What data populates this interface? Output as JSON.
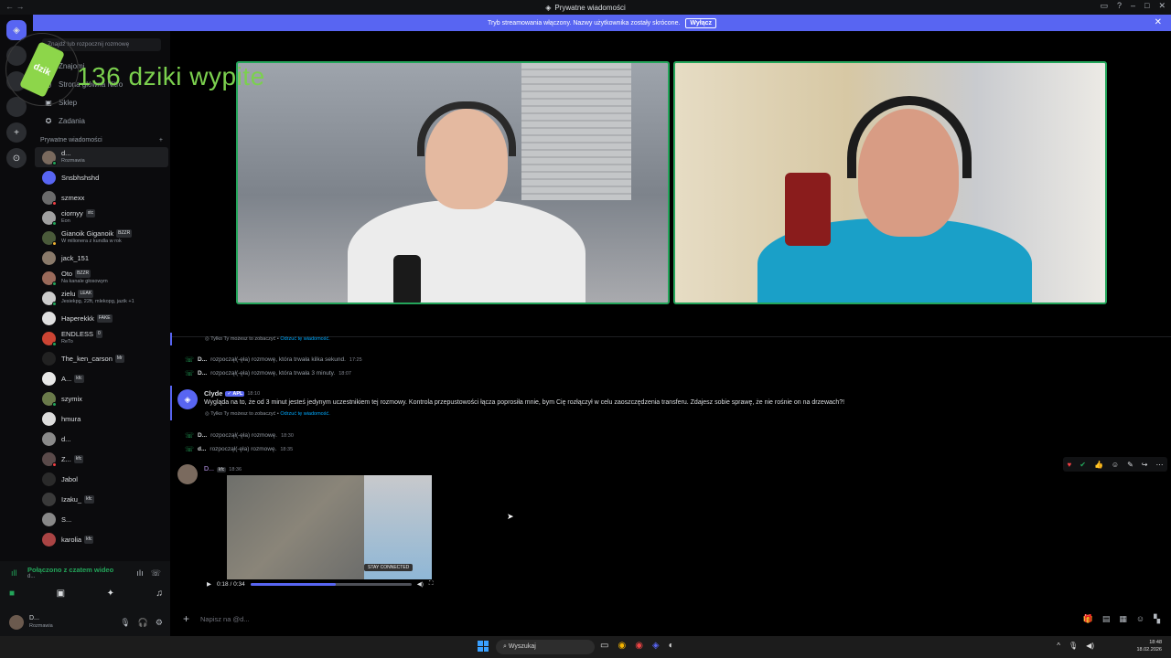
{
  "window": {
    "title": "Prywatne wiadomości"
  },
  "banner": {
    "text": "Tryb streamowania włączony. Nazwy użytkownika zostały skrócone.",
    "button": "Wyłącz"
  },
  "overlay": {
    "text": "136 dziki wypite",
    "logo_text": "dzik"
  },
  "sidebar": {
    "search_placeholder": "Znajdź lub rozpocznij rozmowę",
    "nav": [
      {
        "label": "Znajomi",
        "icon": "friends-icon"
      },
      {
        "label": "Strona główna Nitro",
        "icon": "nitro-icon"
      },
      {
        "label": "Sklep",
        "icon": "shop-icon"
      },
      {
        "label": "Zadania",
        "icon": "quests-icon"
      }
    ],
    "dm_header": "Prywatne wiadomości",
    "dms": [
      {
        "name": "d...",
        "sub": "Rozmawia",
        "color": "#7a6a5e",
        "status": "#23a55a"
      },
      {
        "name": "Snsbhshshd",
        "sub": "",
        "color": "#5865f2",
        "status": ""
      },
      {
        "name": "szmexx",
        "sub": "",
        "color": "#6b6b6b",
        "status": "#f23f43"
      },
      {
        "name": "ciornyy",
        "sub": "Eon",
        "tag": "xtc",
        "color": "#a0a0a0",
        "status": "#23a55a"
      },
      {
        "name": "Gianoik Giganoik",
        "sub": "W milionera z kundla w rok",
        "tag": "BZZR",
        "color": "#4a5a3a",
        "status": "#f0b232"
      },
      {
        "name": "jack_151",
        "sub": "",
        "color": "#8a7a6a",
        "status": ""
      },
      {
        "name": "Oto",
        "sub": "Na kanale głosowym",
        "tag": "BZZR",
        "color": "#9a6a5a",
        "status": "#23a55a"
      },
      {
        "name": "zielu",
        "sub": "Jesiekpg, 22ft, mlekopg, jazik +1",
        "tag": "LEAK",
        "color": "#cccccc",
        "status": "#23a55a"
      },
      {
        "name": "Haperekkk",
        "sub": "",
        "tag": "FAKE",
        "color": "#e0e0e0",
        "status": ""
      },
      {
        "name": "ENDLESS",
        "sub": "ReTo",
        "tag": "0",
        "color": "#c43",
        "status": "#23a55a"
      },
      {
        "name": "The_ken_carson",
        "sub": "",
        "tag": "Mr",
        "color": "#222",
        "status": ""
      },
      {
        "name": "A...",
        "sub": "",
        "tag": "kfc",
        "color": "#e8e8e8",
        "status": ""
      },
      {
        "name": "szymix",
        "sub": "",
        "color": "#6a7a4a",
        "status": "#23a55a"
      },
      {
        "name": "hmura",
        "sub": "",
        "color": "#dddddd",
        "status": ""
      },
      {
        "name": "d...",
        "sub": "",
        "color": "#8a8a8a",
        "status": ""
      },
      {
        "name": "Z...",
        "sub": "",
        "tag": "kfc",
        "color": "#5a4a4a",
        "status": "#f23f43"
      },
      {
        "name": "Jabol",
        "sub": "",
        "color": "#2a2a2a",
        "status": ""
      },
      {
        "name": "Izaku_",
        "sub": "",
        "tag": "kfc",
        "color": "#3a3a3a",
        "status": ""
      },
      {
        "name": "S...",
        "sub": "",
        "color": "#888",
        "status": ""
      },
      {
        "name": "karolia",
        "sub": "",
        "tag": "kfc",
        "color": "#a44",
        "status": ""
      }
    ]
  },
  "voice": {
    "status": "Połączono z czatem wideo",
    "channel": "d..."
  },
  "user": {
    "name": "D...",
    "status": "Rozmawia"
  },
  "messages": {
    "only_you": "Tylko Ty możesz to zobaczyć •",
    "dismiss": "Odrzuć tę wiadomość.",
    "calls": [
      {
        "user": "D...",
        "text": "rozpoczął(-ęła) rozmowę, która trwała kilka sekund.",
        "time": "17:25"
      },
      {
        "user": "D...",
        "text": "rozpoczął(-ęła) rozmowę, która trwała 3 minuty.",
        "time": "18:07"
      },
      {
        "user": "D...",
        "text": "rozpoczął(-ęła) rozmowę.",
        "time": "18:30"
      },
      {
        "user": "d...",
        "text": "rozpoczął(-ęła) rozmowę.",
        "time": "18:35"
      }
    ],
    "clyde": {
      "name": "Clyde",
      "badge": "✓ APL",
      "time": "18:10",
      "text": "Wygląda na to, że od 3 minut jesteś jedynym uczestnikiem tej rozmowy. Kontrola przepustowości łącza poprosiła mnie, bym Cię rozłączył w celu zaoszczędzenia transferu. Zdajesz sobie sprawę, że nie rośnie on na drzewach?!"
    },
    "clip_post": {
      "user": "D...",
      "tag": "kfc",
      "time": "18:36",
      "button": "STAY CONNECTED"
    }
  },
  "player": {
    "time": "0:18 / 0:34",
    "progress": 0.53
  },
  "composer": {
    "placeholder": "Napisz na @d..."
  },
  "taskbar": {
    "search": "Wyszukaj",
    "time": "18:48",
    "date": "18.02.2026"
  }
}
